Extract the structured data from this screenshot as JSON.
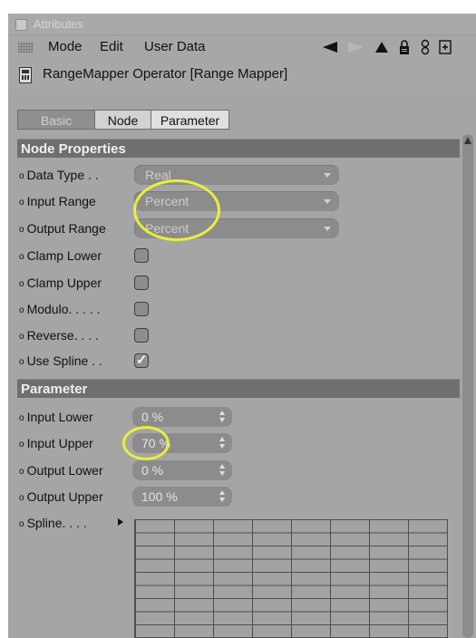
{
  "window": {
    "title": "Attributes"
  },
  "menu": {
    "items": [
      "Mode",
      "Edit",
      "User Data"
    ]
  },
  "object": {
    "title": "RangeMapper Operator [Range Mapper]"
  },
  "tabs": [
    "Basic",
    "Node",
    "Parameter"
  ],
  "sections": {
    "node_properties": {
      "title": "Node Properties",
      "data_type": {
        "label": "Data Type . .",
        "value": "Real"
      },
      "input_range": {
        "label": "Input Range",
        "value": "Percent"
      },
      "output_range": {
        "label": "Output Range",
        "value": "Percent"
      },
      "clamp_lower": {
        "label": "Clamp Lower",
        "checked": false
      },
      "clamp_upper": {
        "label": "Clamp Upper",
        "checked": false
      },
      "modulo": {
        "label": "Modulo. . . . .",
        "checked": false
      },
      "reverse": {
        "label": "Reverse. . . .",
        "checked": false
      },
      "use_spline": {
        "label": "Use Spline . .",
        "checked": true,
        "mark": "✓"
      }
    },
    "parameter": {
      "title": "Parameter",
      "input_lower": {
        "label": "Input Lower",
        "value": "0 %"
      },
      "input_upper": {
        "label": "Input Upper",
        "value": "70 %"
      },
      "output_lower": {
        "label": "Output Lower",
        "value": "0 %"
      },
      "output_upper": {
        "label": "Output Upper",
        "value": "100 %"
      },
      "spline": {
        "label": "Spline. . . ."
      }
    }
  },
  "colors": {
    "highlight": "#e9ef3a",
    "panel": "#a5a5a5",
    "section_header": "#6f6f6f"
  },
  "icons": [
    "back-arrow-icon",
    "forward-arrow-icon",
    "up-arrow-icon",
    "lock-icon",
    "link-icon",
    "new-panel-icon"
  ]
}
